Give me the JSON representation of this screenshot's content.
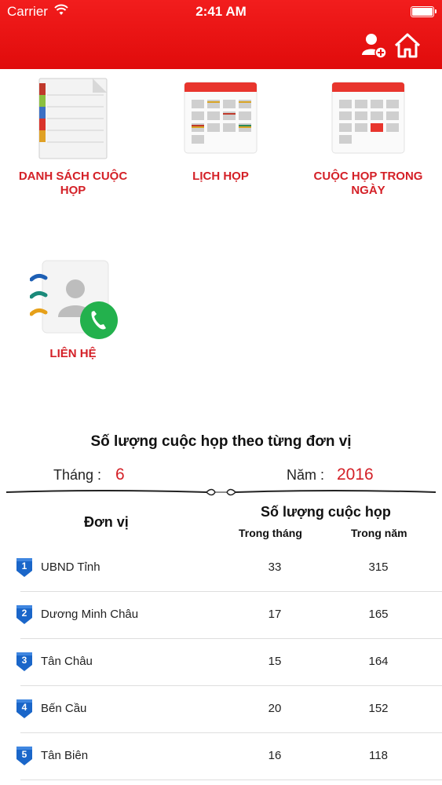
{
  "status_bar": {
    "carrier": "Carrier",
    "time": "2:41 AM"
  },
  "nav": {
    "add_user_icon": "add-user-icon",
    "home_icon": "home-icon"
  },
  "menu": [
    {
      "label": "DANH SÁCH CUỘC HỌP",
      "icon": "document-list-icon"
    },
    {
      "label": "LỊCH HỌP",
      "icon": "calendar-icon"
    },
    {
      "label": "CUỘC HỌP TRONG NGÀY",
      "icon": "calendar-today-icon"
    },
    {
      "label": "LIÊN HỆ",
      "icon": "contact-phone-icon"
    }
  ],
  "stats": {
    "title": "Số lượng cuộc họp theo từng đơn vị",
    "month_label": "Tháng :",
    "month_value": "6",
    "year_label": "Năm :",
    "year_value": "2016",
    "col_unit": "Đơn vị",
    "col_count": "Số lượng cuộc họp",
    "col_month": "Trong tháng",
    "col_year": "Trong năm",
    "rows": [
      {
        "rank": "1",
        "name": "UBND Tỉnh",
        "month": "33",
        "year": "315"
      },
      {
        "rank": "2",
        "name": "Dương Minh Châu",
        "month": "17",
        "year": "165"
      },
      {
        "rank": "3",
        "name": "Tân Châu",
        "month": "15",
        "year": "164"
      },
      {
        "rank": "4",
        "name": "Bến Cầu",
        "month": "20",
        "year": "152"
      },
      {
        "rank": "5",
        "name": "Tân Biên",
        "month": "16",
        "year": "118"
      }
    ]
  },
  "colors": {
    "header_red": "#e80f0f",
    "label_red": "#d42027",
    "badge_blue": "#1a66c9"
  }
}
